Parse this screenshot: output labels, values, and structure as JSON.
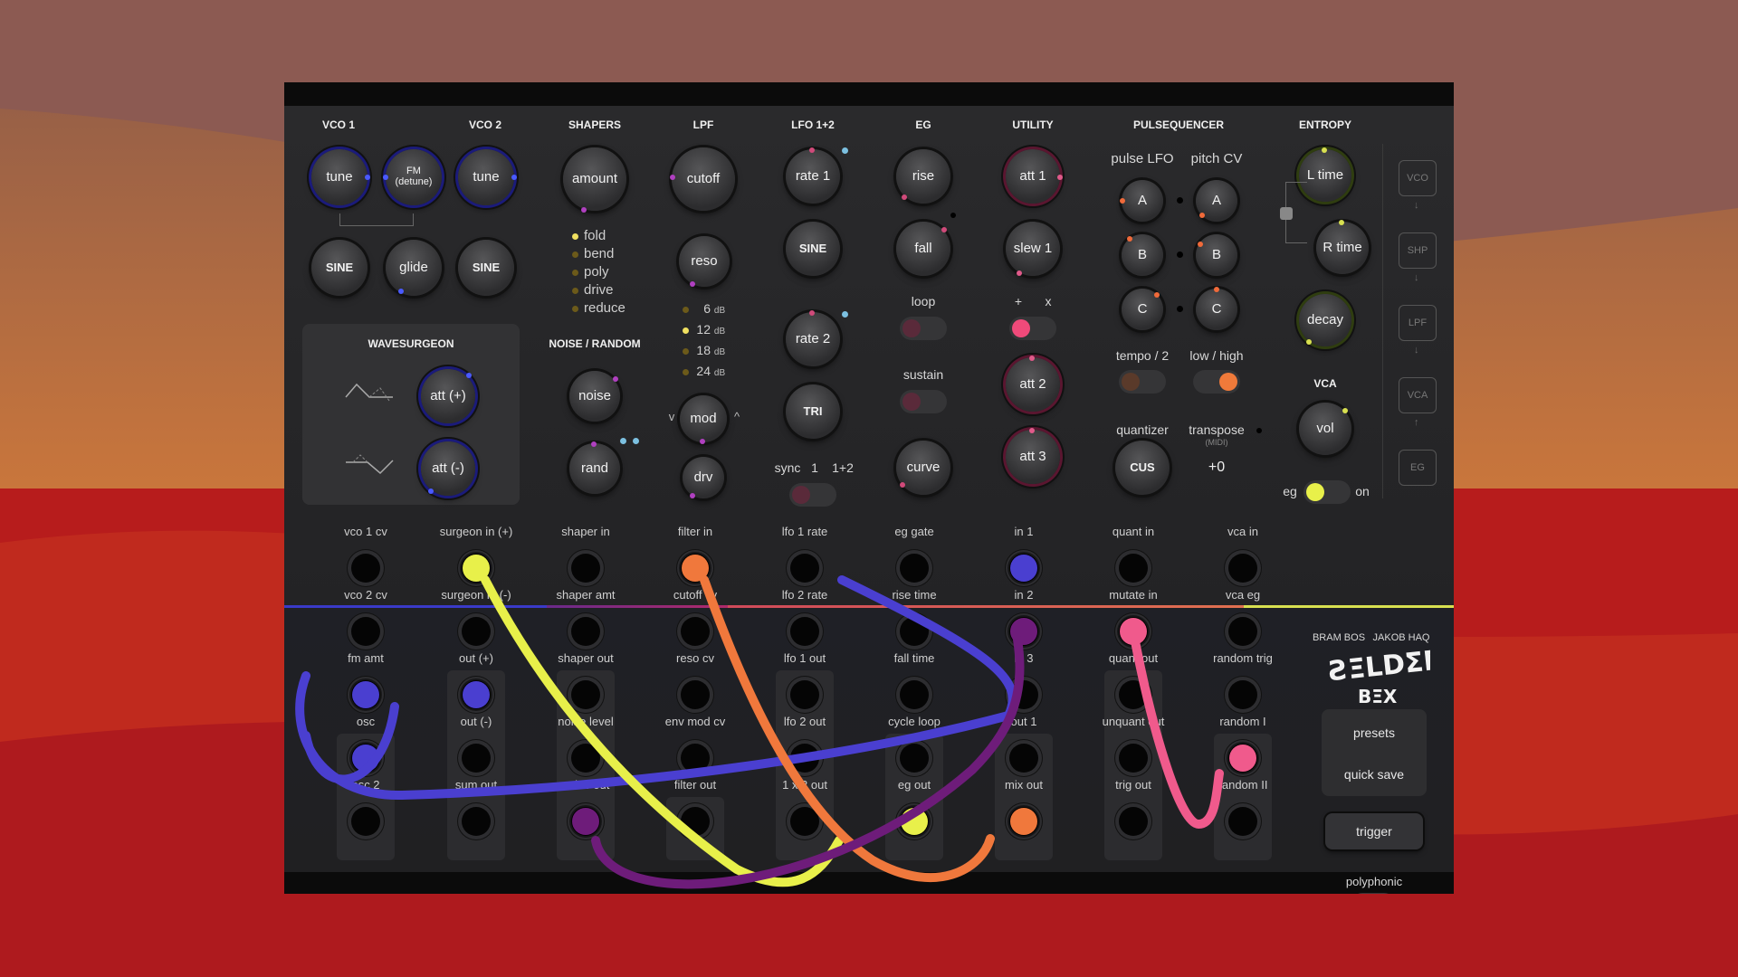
{
  "sections": {
    "vco1": "VCO 1",
    "vco2": "VCO 2",
    "shapers": "SHAPERS",
    "lpf": "LPF",
    "lfo": "LFO 1+2",
    "eg": "EG",
    "utility": "UTILITY",
    "pulsequencer": "PULSEQUENCER",
    "entropy": "ENTROPY",
    "wavesurgeon": "WAVESURGEON",
    "noise_random": "NOISE / RANDOM",
    "vca": "VCA"
  },
  "knobs": {
    "vco1_tune": "tune",
    "fm": "FM",
    "fm_sub": "(detune)",
    "vco2_tune": "tune",
    "vco1_wave": "SINE",
    "glide": "glide",
    "vco2_wave": "SINE",
    "amount": "amount",
    "cutoff": "cutoff",
    "reso": "reso",
    "mod": "mod",
    "drv": "drv",
    "rate1": "rate 1",
    "lfo1_wave": "SINE",
    "rate2": "rate 2",
    "lfo2_wave": "TRI",
    "rise": "rise",
    "fall": "fall",
    "curve": "curve",
    "att1": "att 1",
    "slew1": "slew 1",
    "att2": "att 2",
    "att3": "att 3",
    "pulse_a": "A",
    "pulse_b": "B",
    "pulse_c": "C",
    "pitch_a": "A",
    "pitch_b": "B",
    "pitch_c": "C",
    "quantizer": "CUS",
    "l_time": "L time",
    "r_time": "R time",
    "decay": "decay",
    "vol": "vol",
    "att_plus": "att (+)",
    "att_minus": "att (-)",
    "noise": "noise",
    "rand": "rand"
  },
  "labels": {
    "pulse_lfo": "pulse LFO",
    "pitch_cv": "pitch CV",
    "loop": "loop",
    "sustain": "sustain",
    "plus": "+",
    "times": "x",
    "tempo": "tempo / 2",
    "low_high": "low / high",
    "quantizer": "quantizer",
    "transpose": "transpose",
    "midi": "(MIDI)",
    "transpose_value": "+0",
    "sync": "sync",
    "sync1": "1",
    "sync12": "1+2",
    "eg": "eg",
    "on": "on",
    "mod_left": "v",
    "mod_right": "^"
  },
  "shapers_list": [
    "fold",
    "bend",
    "poly",
    "drive",
    "reduce"
  ],
  "lpf_slopes": [
    {
      "num": "6",
      "unit": "dB"
    },
    {
      "num": "12",
      "unit": "dB"
    },
    {
      "num": "18",
      "unit": "dB"
    },
    {
      "num": "24",
      "unit": "dB"
    }
  ],
  "flow": [
    "VCO",
    "SHP",
    "LPF",
    "VCA",
    "EG"
  ],
  "jacks": {
    "c1": [
      "vco 1 cv",
      "vco 2 cv",
      "fm amt",
      "osc",
      "osc 2"
    ],
    "c2": [
      "surgeon in (+)",
      "surgeon in (-)",
      "out (+)",
      "out (-)",
      "sum out"
    ],
    "c3": [
      "shaper in",
      "shaper amt",
      "shaper out",
      "noise level",
      "noise out"
    ],
    "c4": [
      "filter in",
      "cutoff cv",
      "reso cv",
      "env mod cv",
      "filter out"
    ],
    "c5": [
      "lfo 1 rate",
      "lfo 2 rate",
      "lfo 1 out",
      "lfo 2 out",
      "1 x 2 out"
    ],
    "c6": [
      "eg gate",
      "rise time",
      "fall time",
      "cycle loop",
      "eg out"
    ],
    "c7": [
      "in 1",
      "in 2",
      "in 3",
      "out 1",
      "mix out"
    ],
    "c8": [
      "quant in",
      "mutate in",
      "quant out",
      "unquant out",
      "trig out"
    ],
    "c9": [
      "vca in",
      "vca eg",
      "random trig",
      "random I",
      "random II"
    ]
  },
  "right": {
    "credits_left": "BRAM BOS",
    "credits_right": "JAKOB HAQ",
    "presets": "presets",
    "quick_save": "quick save",
    "trigger": "trigger",
    "polyphonic": "polyphonic"
  },
  "colors": {
    "yellow": "#e8f04a",
    "orange": "#f0783c",
    "blue": "#4a3fd0",
    "purple": "#6e1c7a",
    "pink": "#f05a8c"
  },
  "toggles": {
    "loop": false,
    "sustain": false,
    "mult": true,
    "tempo": false,
    "low_high": true,
    "eg": true,
    "polyphonic": true,
    "sync": false
  }
}
